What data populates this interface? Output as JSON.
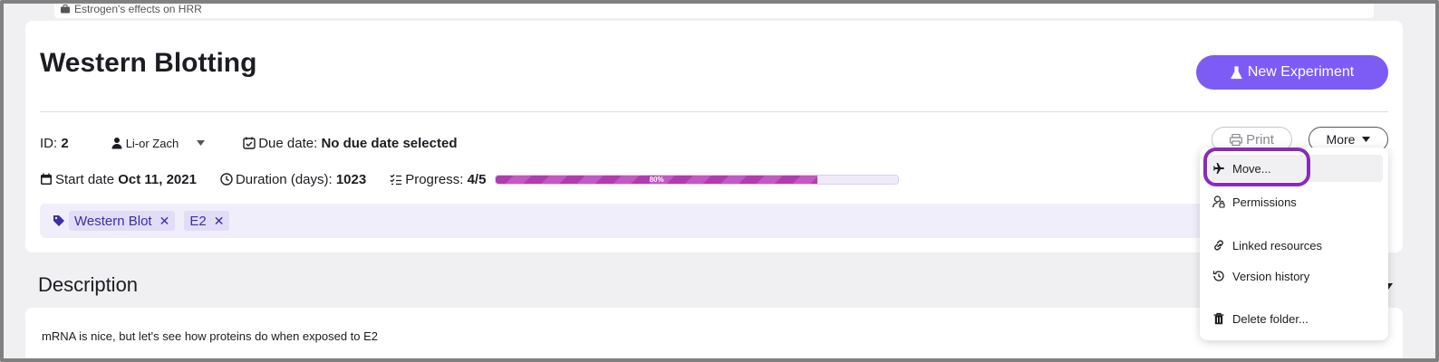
{
  "breadcrumb": {
    "project": "Estrogen's effects on HRR"
  },
  "header": {
    "title": "Western Blotting",
    "new_experiment_label": "New Experiment"
  },
  "meta": {
    "id_label": "ID:",
    "id_value": "2",
    "owner": "Li-or Zach",
    "due_label": "Due date:",
    "due_value": "No due date selected",
    "start_label": "Start date",
    "start_value": "Oct 11, 2021",
    "duration_label": "Duration (days):",
    "duration_value": "1023",
    "progress_label": "Progress:",
    "progress_value": "4/5",
    "progress_percent_text": "80%",
    "progress_fraction": 0.8
  },
  "toolbar": {
    "print_label": "Print",
    "more_label": "More"
  },
  "tags": [
    {
      "label": "Western Blot",
      "remove": "✕"
    },
    {
      "label": "E2",
      "remove": "✕"
    }
  ],
  "description": {
    "heading": "Description",
    "text": "mRNA is nice, but let's see how proteins do when exposed to E2"
  },
  "more_menu": {
    "items": [
      {
        "label": "Move...",
        "icon": "plane-icon"
      },
      {
        "label": "Permissions",
        "icon": "user-lock-icon"
      },
      {
        "label": "Linked resources",
        "icon": "link-icon"
      },
      {
        "label": "Version history",
        "icon": "history-icon"
      },
      {
        "label": "Delete folder...",
        "icon": "trash-icon"
      }
    ]
  },
  "colors": {
    "accent": "#7c5cf5",
    "progress": "#b03cb0",
    "highlight": "#8a2bb8",
    "tag_bg": "#f1eefb"
  }
}
